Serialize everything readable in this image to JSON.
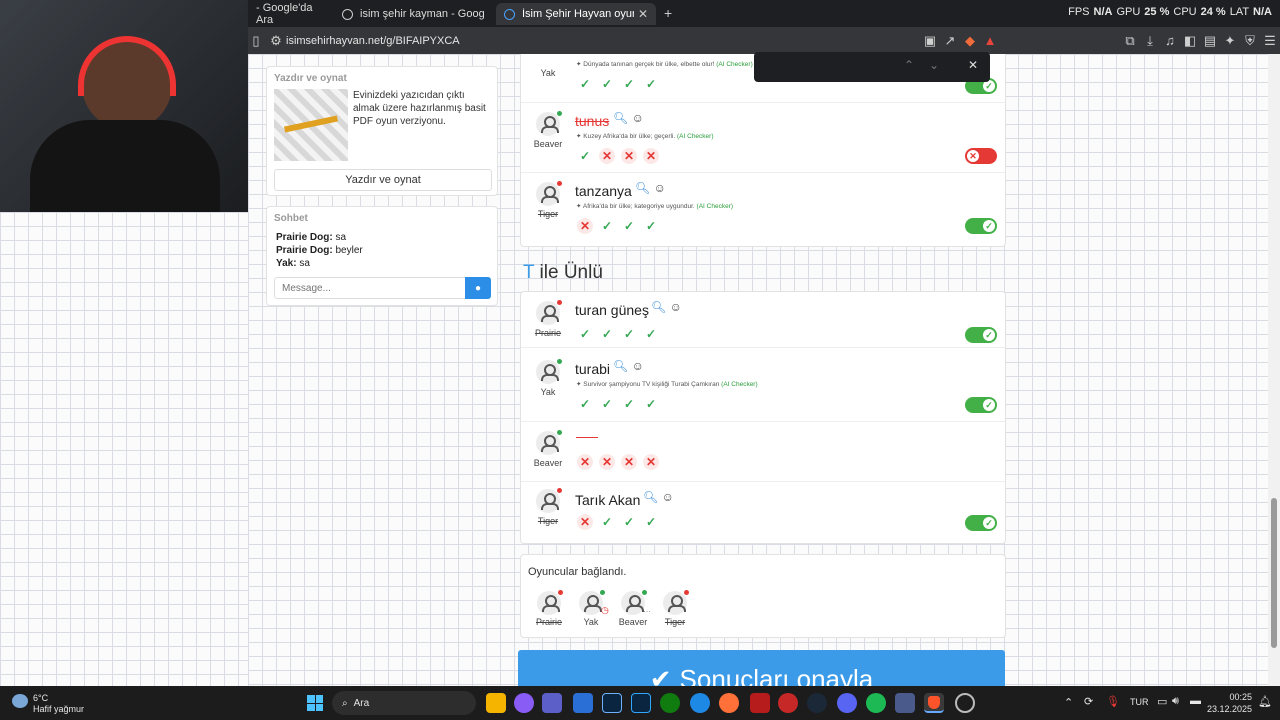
{
  "browser": {
    "tabs": [
      {
        "label": "- Google'da Ara"
      },
      {
        "label": "isim şehir kayman - Google'da Ara"
      },
      {
        "label": "İsim Şehir Hayvan oyununa katıl"
      }
    ],
    "url": "isimsehirhayvan.net/g/BIFAIPYXCA",
    "perf": {
      "fps_label": "FPS",
      "fps": "N/A",
      "gpu_label": "GPU",
      "gpu": "25 %",
      "cpu_label": "CPU",
      "cpu": "24 %",
      "lat_label": "LAT",
      "lat": "N/A"
    }
  },
  "sidebar": {
    "print_card": {
      "title": "Yazdır ve oynat",
      "text": "Evinizdeki yazıcıdan çıktı almak üzere hazırlanmış basit PDF oyun verziyonu.",
      "button": "Yazdır ve oynat"
    },
    "chat": {
      "title": "Sohbet",
      "messages": [
        {
          "user": "Prairie Dog:",
          "text": "sa"
        },
        {
          "user": "Prairie Dog:",
          "text": "beyler"
        },
        {
          "user": "Yak:",
          "text": "sa"
        }
      ],
      "input_placeholder": "Message..."
    }
  },
  "country_section": {
    "rows": [
      {
        "player": "Yak",
        "word": "",
        "note": "Dünyada tanınan gerçek bir ülke, elbette olur!",
        "ai": "(AI Checker)",
        "votes": [
          "ok",
          "ok",
          "ok",
          "ok"
        ],
        "toggle": "on"
      },
      {
        "player": "Beaver",
        "word": "tunus",
        "note": "Kuzey Afrika'da bir ülke; geçerli.",
        "ai": "(AI Checker)",
        "votes": [
          "ok",
          "no",
          "no",
          "no"
        ],
        "toggle": "off"
      },
      {
        "player": "Tiger",
        "word": "tanzanya",
        "note": "Afrika'da bir ülke; kategoriye uygundur.",
        "ai": "(AI Checker)",
        "votes": [
          "no",
          "ok",
          "ok",
          "ok"
        ],
        "toggle": "on"
      }
    ]
  },
  "famous_section": {
    "letter": "T",
    "title": " ile Ünlü",
    "rows": [
      {
        "player": "Prairie",
        "word": "turan güneş",
        "note": "",
        "ai": "",
        "votes": [
          "ok",
          "ok",
          "ok",
          "ok"
        ],
        "toggle": "on"
      },
      {
        "player": "Yak",
        "word": "turabi",
        "note": "Survivor şampiyonu TV kişiliği Turabi Çamkıran",
        "ai": "(AI Checker)",
        "votes": [
          "ok",
          "ok",
          "ok",
          "ok"
        ],
        "toggle": "on"
      },
      {
        "player": "Beaver",
        "word": "",
        "note": "",
        "ai": "",
        "votes": [
          "no",
          "no",
          "no",
          "no"
        ],
        "toggle": ""
      },
      {
        "player": "Tiger",
        "word": "Tarık Akan",
        "note": "",
        "ai": "",
        "votes": [
          "no",
          "ok",
          "ok",
          "ok"
        ],
        "toggle": "on"
      }
    ]
  },
  "players_box": {
    "status": "Oyuncular bağlandı.",
    "players": [
      "Prairie",
      "Yak",
      "Beaver",
      "Tiger"
    ]
  },
  "confirm_button": "Sonuçları onayla",
  "taskbar": {
    "weather_temp": "6°C",
    "weather_desc": "Hafif yağmur",
    "search_placeholder": "Ara",
    "lang": "TUR",
    "time": "00:25",
    "date": "23.12.2025"
  },
  "colors": {
    "accent": "#3b9be8",
    "ok": "#34a853",
    "no": "#e53935"
  }
}
